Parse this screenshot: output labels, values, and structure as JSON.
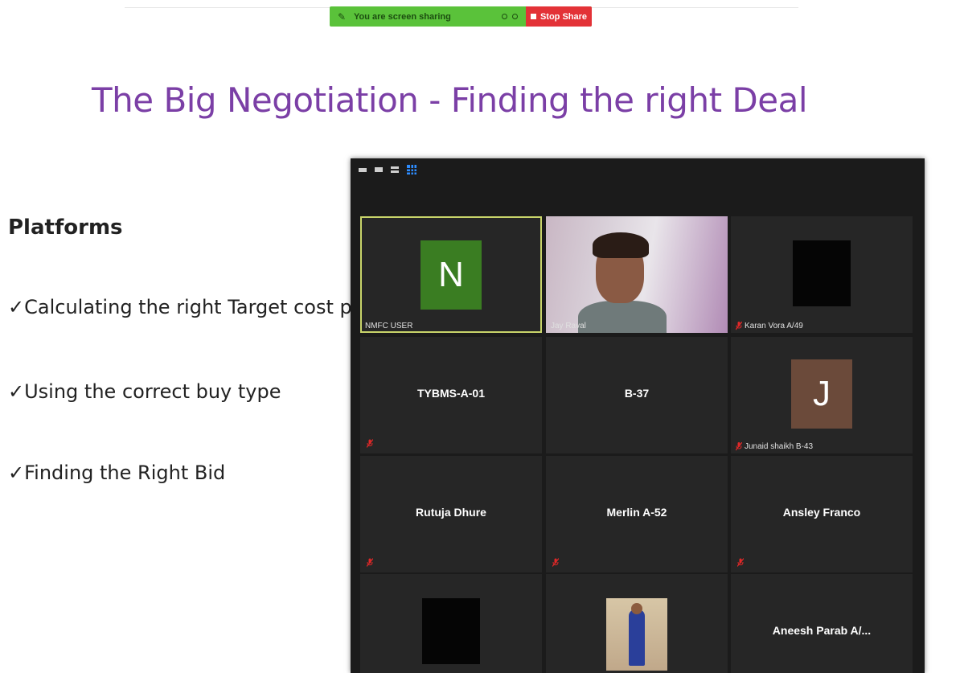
{
  "share_bar": {
    "label": "You are screen sharing",
    "stop_label": "Stop Share",
    "bar_color": "#5ac23a",
    "stop_color": "#e33237"
  },
  "slide": {
    "title": "The Big Negotiation - Finding the right Deal",
    "heading": "Platforms",
    "bullets": [
      "✓Calculating the right Target cost p",
      "✓Using the correct buy type",
      "✓Finding the Right Bid"
    ],
    "title_color": "#7b3fa6"
  },
  "gallery": {
    "participants": [
      {
        "name": "NMFC USER",
        "avatar_letter": "N",
        "avatar_color": "#3a7d22",
        "active": true,
        "display": "avatar-corner"
      },
      {
        "name": "Jay Raval",
        "display": "video"
      },
      {
        "name": "Karan Vora A/49",
        "display": "black-avatar",
        "muted": true
      },
      {
        "name": "TYBMS-A-01",
        "display": "name",
        "muted": true
      },
      {
        "name": "B-37",
        "display": "name",
        "muted": false
      },
      {
        "name": "Junaid shaikh B-43",
        "avatar_letter": "J",
        "avatar_color": "#6b4a3a",
        "display": "avatar-corner",
        "muted": true
      },
      {
        "name": "Rutuja Dhure",
        "display": "name",
        "muted": true
      },
      {
        "name": "Merlin A-52",
        "display": "name",
        "muted": true
      },
      {
        "name": "Ansley Franco",
        "display": "name",
        "muted": true
      },
      {
        "name": "",
        "display": "black-avatar"
      },
      {
        "name": "",
        "display": "photo"
      },
      {
        "name": "Aneesh Parab A/...",
        "display": "name"
      }
    ]
  }
}
